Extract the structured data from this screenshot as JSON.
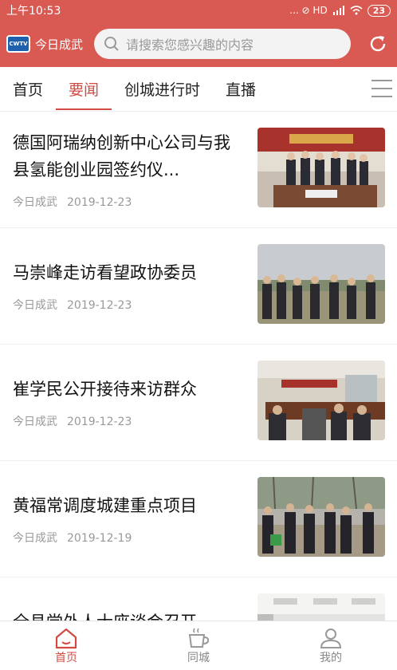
{
  "status_bar": {
    "time": "上午10:53",
    "indicators": "... ⊘ HD",
    "battery": "23"
  },
  "header": {
    "brand_logo": "CWTV",
    "brand_name": "今日成武",
    "search_placeholder": "请搜索您感兴趣的内容"
  },
  "tabs": [
    {
      "label": "首页"
    },
    {
      "label": "要闻"
    },
    {
      "label": "创城进行时"
    },
    {
      "label": "直播"
    }
  ],
  "active_tab": "要闻",
  "feed": [
    {
      "title": "德国阿瑞纳创新中心公司与我县氢能创业园签约仪...",
      "source": "今日成武",
      "date": "2019-12-23"
    },
    {
      "title": "马崇峰走访看望政协委员",
      "source": "今日成武",
      "date": "2019-12-23"
    },
    {
      "title": "崔学民公开接待来访群众",
      "source": "今日成武",
      "date": "2019-12-23"
    },
    {
      "title": "黄福常调度城建重点项目",
      "source": "今日成武",
      "date": "2019-12-19"
    },
    {
      "title": "全县党外人士座谈会召开",
      "source": "",
      "date": ""
    }
  ],
  "bottom_nav": [
    {
      "label": "首页",
      "icon": "home-icon"
    },
    {
      "label": "同城",
      "icon": "coffee-cup-icon"
    },
    {
      "label": "我的",
      "icon": "user-icon"
    }
  ],
  "colors": {
    "brand_red": "#d85a52",
    "accent": "#d14b43"
  }
}
